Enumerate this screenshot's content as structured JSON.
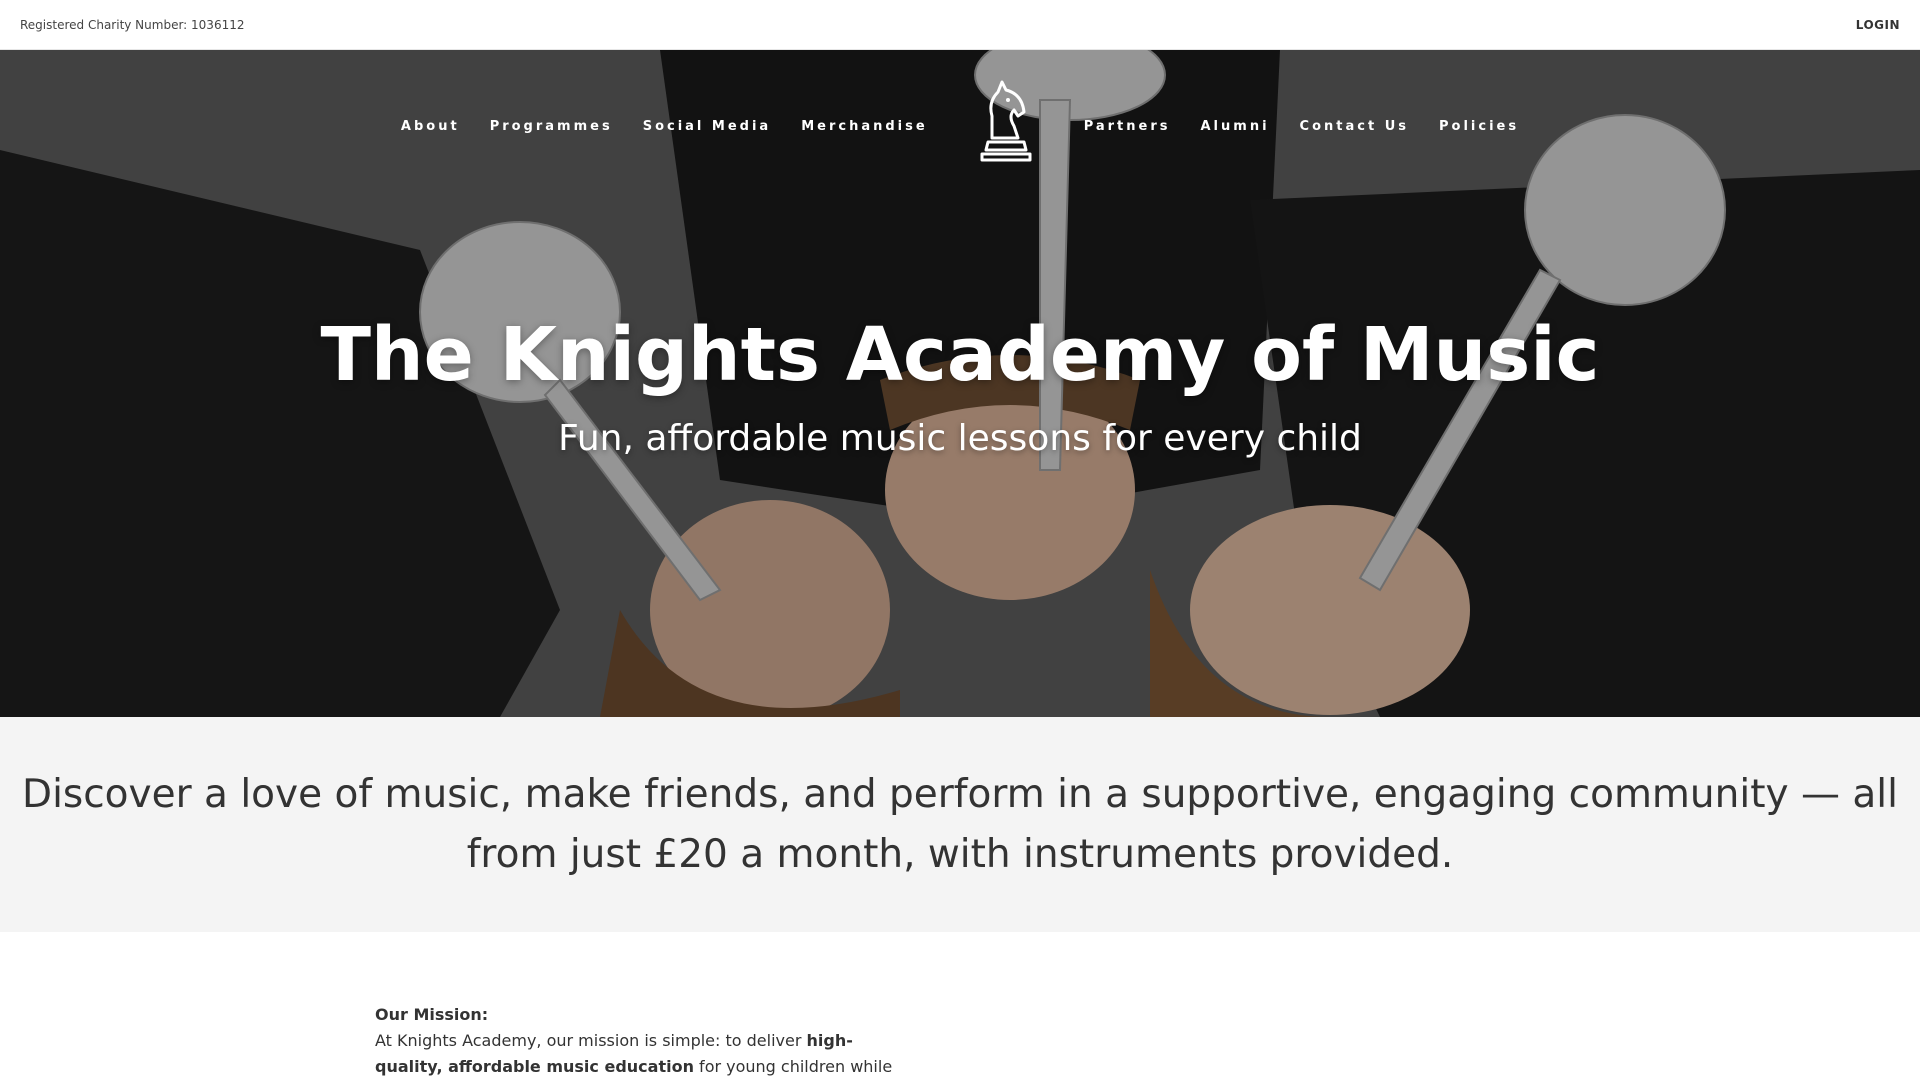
{
  "topbar": {
    "charity_text": "Registered Charity Number: 1036112",
    "login_label": "LOGIN"
  },
  "nav": {
    "left": [
      "About",
      "Programmes",
      "Social Media",
      "Merchandise"
    ],
    "right": [
      "Partners",
      "Alumni",
      "Contact Us",
      "Policies"
    ],
    "logo_icon": "knight-chess-piece-icon"
  },
  "hero": {
    "title": "The Knights Academy of Music",
    "subtitle": "Fun, affordable music lessons for every child",
    "image": "children-lying-on-floor-playing-trumpets"
  },
  "band": {
    "text": "Discover a love of music, make friends, and perform in a supportive, engaging community — all from just £20 a month, with instruments provided."
  },
  "mission": {
    "heading": "Our Mission:",
    "text_1": "At Knights Academy, our mission is simple: to deliver ",
    "bold_1": "high-quality, affordable music education",
    "text_2": " for young children while nurturing their"
  },
  "colors": {
    "band_bg": "#f4f4f4",
    "text": "#333333",
    "hero_text": "#ffffff"
  }
}
